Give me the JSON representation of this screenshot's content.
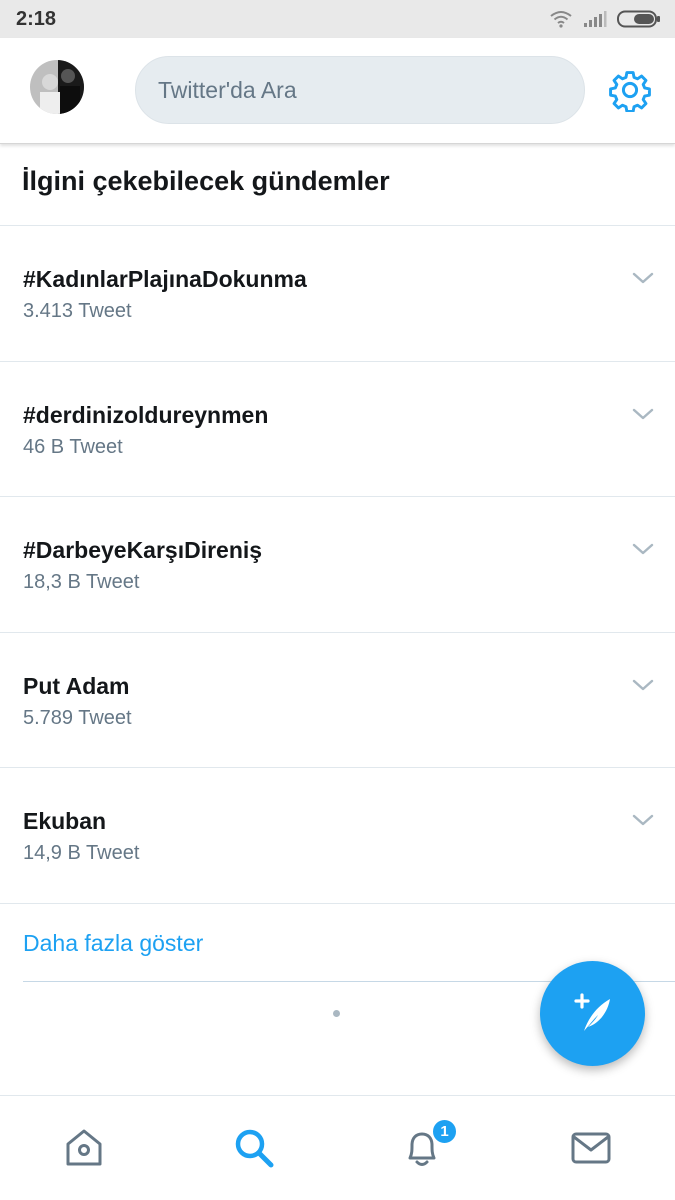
{
  "status_bar": {
    "time": "2:18",
    "icons": [
      "wifi-icon",
      "signal-icon",
      "battery-icon"
    ]
  },
  "header": {
    "avatar_icon": "profile-avatar",
    "search_placeholder": "Twitter'da Ara",
    "settings_icon": "gear-icon"
  },
  "section": {
    "title": "İlgini çekebilecek gündemler"
  },
  "trends": [
    {
      "name": "#KadınlarPlajınaDokunma",
      "count": "3.413 Tweet"
    },
    {
      "name": "#derdinizoldureynmen",
      "count": "46 B Tweet"
    },
    {
      "name": "#DarbeyeKarşıDireniş",
      "count": "18,3 B Tweet"
    },
    {
      "name": "Put Adam",
      "count": "5.789 Tweet"
    },
    {
      "name": "Ekuban",
      "count": "14,9 B Tweet"
    }
  ],
  "show_more": "Daha fazla göster",
  "fab_icon": "compose-tweet-icon",
  "bottom_nav": {
    "items": [
      "home-icon",
      "search-icon",
      "notifications-icon",
      "messages-icon"
    ],
    "notification_badge": "1",
    "active": "search-icon"
  },
  "colors": {
    "accent": "#1da1f2",
    "text": "#14171a",
    "secondary": "#657786",
    "search_bg": "#e6ecf0"
  }
}
